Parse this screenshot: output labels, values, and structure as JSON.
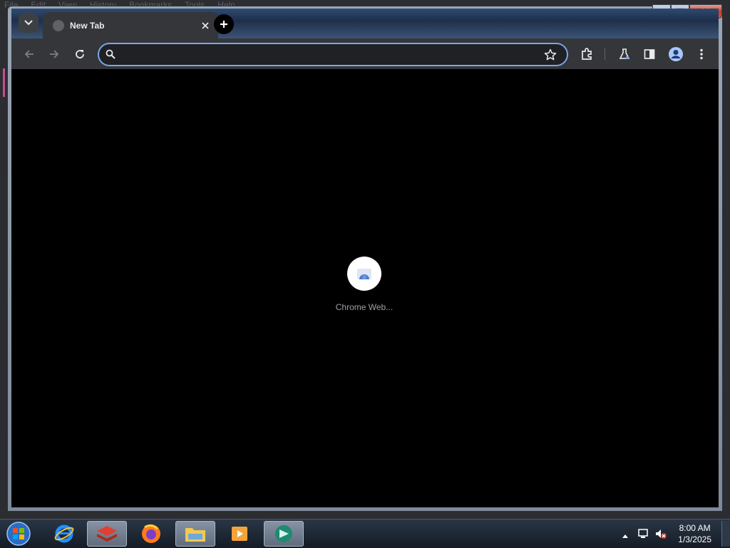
{
  "background_app": {
    "menu": [
      "File",
      "Edit",
      "View",
      "History",
      "Bookmarks",
      "Tools",
      "Help"
    ]
  },
  "browser": {
    "tab": {
      "title": "New Tab",
      "close_glyph": "✕"
    },
    "new_tab_glyph": "+",
    "caption": {
      "minimize_glyph": "▁",
      "maximize_glyph": "▢",
      "close_glyph": "✕"
    },
    "toolbar": {
      "back_icon": "arrow-back-icon",
      "forward_icon": "arrow-forward-icon",
      "reload_icon": "reload-icon",
      "extensions_icon": "puzzle-icon",
      "labs_icon": "flask-icon",
      "side_panel_icon": "side-panel-icon",
      "profile_icon": "profile-icon",
      "menu_icon": "kebab-menu-icon"
    },
    "omnibox": {
      "value": "",
      "placeholder": ""
    },
    "content": {
      "shortcuts": [
        {
          "label": "Chrome Web..."
        }
      ]
    }
  },
  "taskbar": {
    "apps": [
      {
        "name": "start-orb"
      },
      {
        "name": "internet-explorer"
      },
      {
        "name": "app-red-stack"
      },
      {
        "name": "firefox"
      },
      {
        "name": "file-explorer"
      },
      {
        "name": "media-player"
      },
      {
        "name": "chrome-remote"
      }
    ],
    "clock": {
      "time": "8:00 AM",
      "date": "1/3/2025"
    }
  },
  "colors": {
    "accent_focus": "#7aa7e8",
    "toolbar": "#35363a",
    "content_bg": "#000000"
  }
}
